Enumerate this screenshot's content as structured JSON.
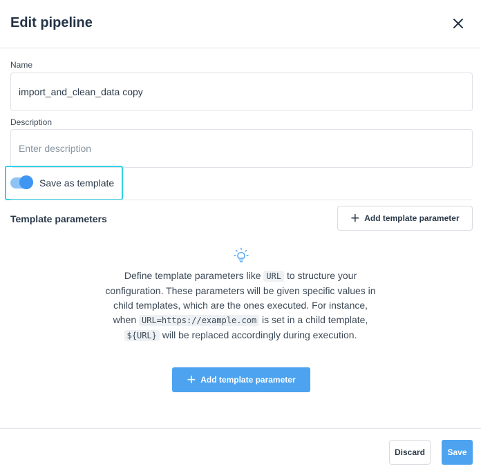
{
  "dialog": {
    "title": "Edit pipeline",
    "close_icon": "close-icon"
  },
  "form": {
    "name": {
      "label": "Name",
      "value": "import_and_clean_data copy",
      "placeholder": ""
    },
    "description": {
      "label": "Description",
      "value": "",
      "placeholder": "Enter description"
    },
    "template_toggle": {
      "label": "Save as template",
      "checked": true
    }
  },
  "template_parameters": {
    "title": "Template parameters",
    "add_button_label": "Add template parameter",
    "empty_state": {
      "icon": "lightbulb-icon",
      "text_1": "Define template parameters like ",
      "code_1": "URL",
      "text_2": " to structure your configuration. These parameters will be given specific values in child templates, which are the ones executed. For instance, when ",
      "code_2": "URL=https://example.com",
      "text_3": " is set in a child template, ",
      "code_3": "${URL}",
      "text_4": " will be replaced accordingly during execution.",
      "add_button_label": "Add template parameter"
    }
  },
  "footer": {
    "discard_label": "Discard",
    "save_label": "Save"
  },
  "colors": {
    "accent": "#4da3f0",
    "focus_outline": "#33d1e6",
    "toggle_knob": "#3f95f2",
    "toggle_track": "#8fc3f5"
  }
}
